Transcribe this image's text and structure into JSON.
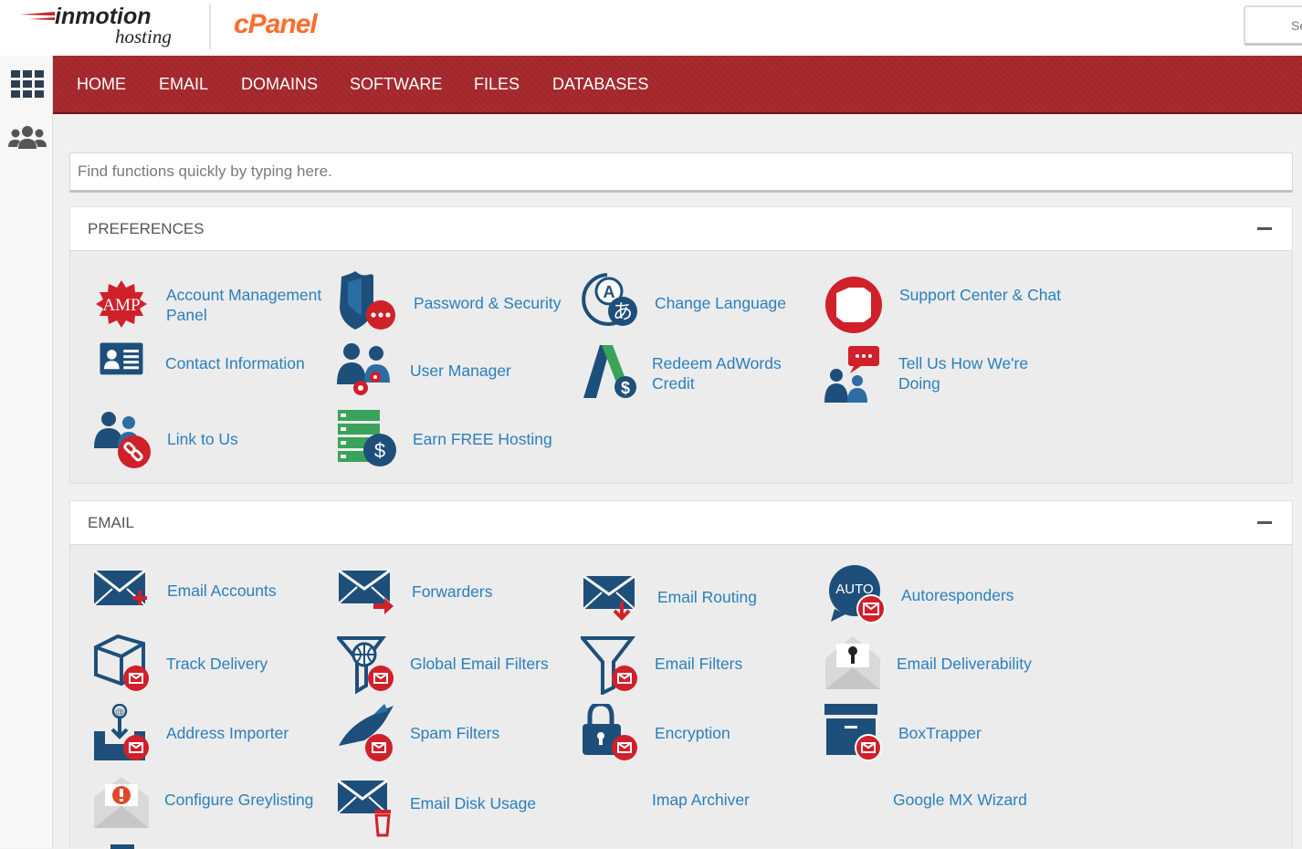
{
  "brand": {
    "inmotion_top": "inmotion",
    "inmotion_bottom": "hosting",
    "cpanel": "cPanel"
  },
  "header_search": {
    "value": "Se"
  },
  "nav": {
    "items": [
      "HOME",
      "EMAIL",
      "DOMAINS",
      "SOFTWARE",
      "FILES",
      "DATABASES"
    ]
  },
  "search": {
    "placeholder": "Find functions quickly by typing here."
  },
  "preferences": {
    "title": "PREFERENCES",
    "items": [
      {
        "label": "Account Management Panel",
        "icon": "amp-icon"
      },
      {
        "label": "Password & Security",
        "icon": "shield-password-icon"
      },
      {
        "label": "Change Language",
        "icon": "language-icon"
      },
      {
        "label": "Support Center & Chat",
        "icon": "lifebuoy-icon"
      },
      {
        "label": "Contact Information",
        "icon": "contact-card-icon"
      },
      {
        "label": "User Manager",
        "icon": "user-manager-icon"
      },
      {
        "label": "Redeem AdWords Credit",
        "icon": "adwords-icon"
      },
      {
        "label": "Tell Us How We're Doing",
        "icon": "feedback-icon"
      },
      {
        "label": "Link to Us",
        "icon": "link-users-icon"
      },
      {
        "label": "Earn FREE Hosting",
        "icon": "earn-hosting-icon"
      }
    ],
    "amp_badge": "AMP"
  },
  "email": {
    "title": "EMAIL",
    "items": [
      {
        "label": "Email Accounts",
        "icon": "email-add-icon"
      },
      {
        "label": "Forwarders",
        "icon": "email-forward-icon"
      },
      {
        "label": "Email Routing",
        "icon": "email-routing-icon"
      },
      {
        "label": "Autoresponders",
        "icon": "autoresponder-icon"
      },
      {
        "label": "Track Delivery",
        "icon": "track-delivery-icon"
      },
      {
        "label": "Global Email Filters",
        "icon": "global-filter-icon"
      },
      {
        "label": "Email Filters",
        "icon": "email-filter-icon"
      },
      {
        "label": "Email Deliverability",
        "icon": "deliverability-icon"
      },
      {
        "label": "Address Importer",
        "icon": "address-importer-icon"
      },
      {
        "label": "Spam Filters",
        "icon": "spam-filter-icon"
      },
      {
        "label": "Encryption",
        "icon": "lock-icon"
      },
      {
        "label": "BoxTrapper",
        "icon": "boxtrapper-icon"
      },
      {
        "label": "Configure Greylisting",
        "icon": "greylisting-icon"
      },
      {
        "label": "Email Disk Usage",
        "icon": "disk-usage-icon"
      },
      {
        "label": "Imap Archiver",
        "icon": ""
      },
      {
        "label": "Google MX Wizard",
        "icon": ""
      }
    ],
    "auto_badge": "AUTO"
  },
  "colors": {
    "nav": "#a3262b",
    "link": "#2a7fbd",
    "icon_blue": "#1e5a8a",
    "icon_red": "#d0202a",
    "cpanel_orange": "#ff6c2c"
  }
}
